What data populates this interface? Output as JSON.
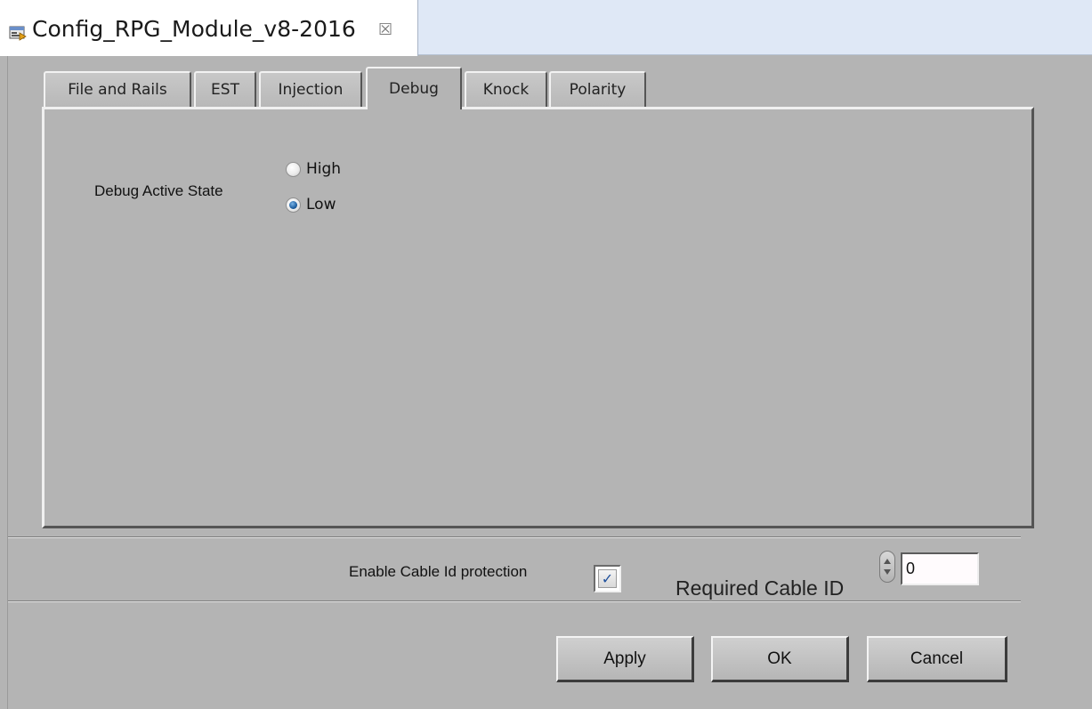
{
  "editor": {
    "title": "Config_RPG_Module_v8-2016",
    "close_glyph": "☒",
    "icon": "config-file-icon"
  },
  "tabs": [
    {
      "label": "File and Rails",
      "active": false
    },
    {
      "label": "EST",
      "active": false
    },
    {
      "label": "Injection",
      "active": false
    },
    {
      "label": "Debug",
      "active": true
    },
    {
      "label": "Knock",
      "active": false
    },
    {
      "label": "Polarity",
      "active": false
    }
  ],
  "debug_panel": {
    "label": "Debug Active State",
    "options": [
      {
        "label": "High",
        "selected": false
      },
      {
        "label": "Low",
        "selected": true
      }
    ]
  },
  "cable": {
    "enable_label": "Enable Cable Id protection",
    "enabled": true,
    "required_label": "Required Cable ID",
    "required_value": "0"
  },
  "buttons": {
    "apply": "Apply",
    "ok": "OK",
    "cancel": "Cancel"
  },
  "colors": {
    "panel_bg": "#b4b4b4",
    "tab_strip_bg": "#dfe8f6",
    "radio_selected": "#1f5fa0",
    "check_mark": "#1d4f9c"
  }
}
